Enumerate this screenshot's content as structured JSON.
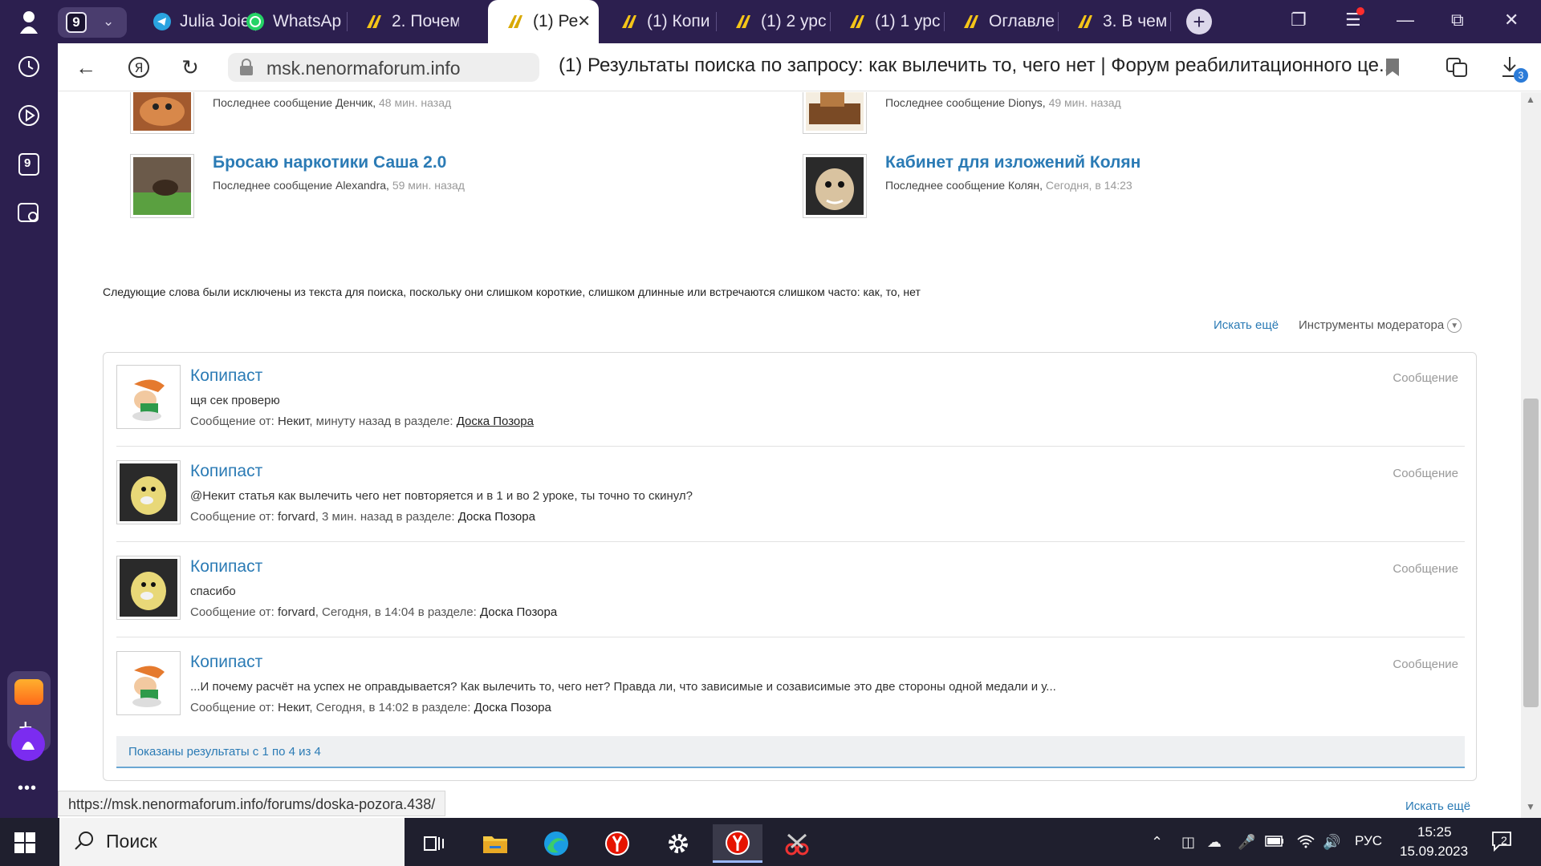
{
  "browser": {
    "tab_counter": "9",
    "tabs": [
      {
        "label": "Julia Joie",
        "icon": "telegram-icon"
      },
      {
        "label": "WhatsAp",
        "icon": "whatsapp-icon"
      },
      {
        "label": "2. Почем",
        "icon": "forum-favicon-icon"
      },
      {
        "label": "(1) Ре",
        "icon": "forum-favicon-icon",
        "active": true
      },
      {
        "label": "(1) Копи",
        "icon": "forum-favicon-icon"
      },
      {
        "label": "(1) 2 урс",
        "icon": "forum-favicon-icon"
      },
      {
        "label": "(1) 1 урс",
        "icon": "forum-favicon-icon"
      },
      {
        "label": "Оглавле",
        "icon": "forum-favicon-icon"
      },
      {
        "label": "3. В чем",
        "icon": "forum-favicon-icon"
      }
    ],
    "url": "msk.nenormaforum.info",
    "page_title": "(1) Результаты поиска по запросу: как вылечить то, чего нет | Форум реабилитационного це...",
    "downloads_badge": "3",
    "sidebar_counter": "9"
  },
  "threads": [
    {
      "title": "",
      "meta_prefix": "Последнее сообщение ",
      "author": "Денчик",
      "time": "48 мин. назад"
    },
    {
      "title": "",
      "meta_prefix": "Последнее сообщение ",
      "author": "Dionys",
      "time": "49 мин. назад"
    },
    {
      "title": "Бросаю наркотики Саша 2.0",
      "meta_prefix": "Последнее сообщение ",
      "author": "Alexandra",
      "time": "59 мин. назад"
    },
    {
      "title": "Кабинет для изложений Колян",
      "meta_prefix": "Последнее сообщение ",
      "author": "Колян",
      "time": "Сегодня, в 14:23"
    }
  ],
  "search": {
    "excluded_note": "Следующие слова были исключены из текста для поиска, поскольку они слишком короткие, слишком длинные или встречаются слишком часто: как, то, нет",
    "search_more": "Искать ещё",
    "moderator_tools": "Инструменты модератора",
    "results": [
      {
        "title": "Копипаст",
        "snippet": "щя сек проверю",
        "meta_label": "Сообщение от: ",
        "author": "Некит",
        "time": ", минуту назад в разделе: ",
        "forum": "Доска Позора",
        "type": "Сообщение"
      },
      {
        "title": "Копипаст",
        "snippet": "@Некит статья как вылечить чего нет повторяется и в 1 и во 2 уроке, ты точно то скинул?",
        "meta_label": "Сообщение от: ",
        "author": "forvard",
        "time": ", 3 мин. назад в разделе: ",
        "forum": "Доска Позора",
        "type": "Сообщение"
      },
      {
        "title": "Копипаст",
        "snippet": "спасибо",
        "meta_label": "Сообщение от: ",
        "author": "forvard",
        "time": ", Сегодня, в 14:04 в разделе: ",
        "forum": "Доска Позора",
        "type": "Сообщение"
      },
      {
        "title": "Копипаст",
        "snippet": "...И почему расчёт на успех не оправдывается? Как вылечить то, чего нет? Правда ли, что зависимые и созависимые это две стороны одной медали и у...",
        "meta_label": "Сообщение от: ",
        "author": "Некит",
        "time": ", Сегодня, в 14:02 в разделе: ",
        "forum": "Доска Позора",
        "type": "Сообщение"
      }
    ],
    "footer": "Показаны результаты с 1 по 4 из 4",
    "search_more_bottom": "Искать ещё"
  },
  "status_url": "https://msk.nenormaforum.info/forums/doska-pozora.438/",
  "taskbar": {
    "search_placeholder": "Поиск",
    "language": "РУС",
    "time": "15:25",
    "date": "15.09.2023",
    "notifications": "2"
  },
  "colors": {
    "browser_chrome": "#2c1f4f",
    "link": "#2b7bb5",
    "taskbar": "#1f1f2e"
  }
}
